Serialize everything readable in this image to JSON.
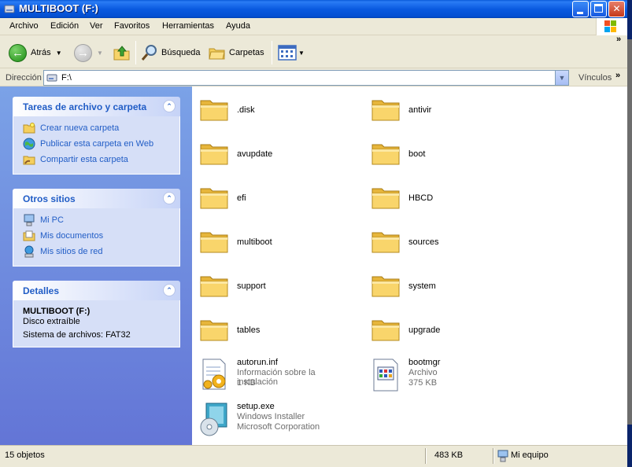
{
  "window": {
    "title": "MULTIBOOT (F:)"
  },
  "menu": {
    "items": [
      "Archivo",
      "Edición",
      "Ver",
      "Favoritos",
      "Herramientas",
      "Ayuda"
    ]
  },
  "toolbar": {
    "back_label": "Atrás",
    "search_label": "Búsqueda",
    "folders_label": "Carpetas"
  },
  "address": {
    "label": "Dirección",
    "value": "F:\\",
    "links_label": "Vínculos"
  },
  "sidebar": {
    "tasks": {
      "title": "Tareas de archivo y carpeta",
      "items": [
        {
          "label": "Crear nueva carpeta",
          "icon": "new-folder-icon"
        },
        {
          "label": "Publicar esta carpeta en Web",
          "icon": "web-publish-icon"
        },
        {
          "label": "Compartir esta carpeta",
          "icon": "share-folder-icon"
        }
      ]
    },
    "places": {
      "title": "Otros sitios",
      "items": [
        {
          "label": "Mi PC",
          "icon": "my-computer-icon"
        },
        {
          "label": "Mis documentos",
          "icon": "my-documents-icon"
        },
        {
          "label": "Mis sitios de red",
          "icon": "network-places-icon"
        }
      ]
    },
    "details": {
      "title": "Detalles",
      "name": "MULTIBOOT (F:)",
      "type": "Disco extraíble",
      "filesystem": "Sistema de archivos: FAT32"
    }
  },
  "files": [
    {
      "name": ".disk",
      "kind": "folder"
    },
    {
      "name": "antivir",
      "kind": "folder"
    },
    {
      "name": "avupdate",
      "kind": "folder"
    },
    {
      "name": "boot",
      "kind": "folder"
    },
    {
      "name": "efi",
      "kind": "folder"
    },
    {
      "name": "HBCD",
      "kind": "folder"
    },
    {
      "name": "multiboot",
      "kind": "folder"
    },
    {
      "name": "sources",
      "kind": "folder"
    },
    {
      "name": "support",
      "kind": "folder"
    },
    {
      "name": "system",
      "kind": "folder"
    },
    {
      "name": "tables",
      "kind": "folder"
    },
    {
      "name": "upgrade",
      "kind": "folder"
    },
    {
      "name": "autorun.inf",
      "kind": "inf",
      "line1": "Información sobre la instalación",
      "line2": "1 KB"
    },
    {
      "name": "bootmgr",
      "kind": "file",
      "line1": "Archivo",
      "line2": "375 KB"
    },
    {
      "name": "setup.exe",
      "kind": "exe",
      "line1": "Windows Installer",
      "line2": "Microsoft Corporation"
    }
  ],
  "status": {
    "count": "15 objetos",
    "size": "483 KB",
    "location": "Mi equipo"
  }
}
